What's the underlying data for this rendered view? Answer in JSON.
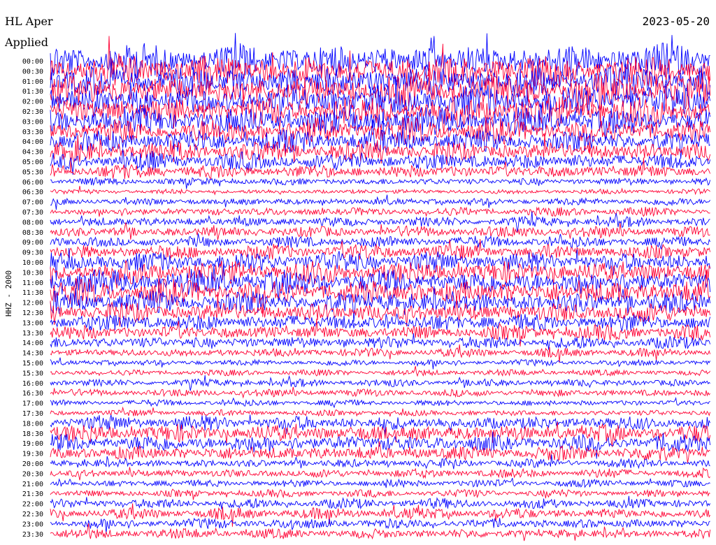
{
  "header": {
    "station": "HL Aper",
    "filter_note": "Applied",
    "date": "2023-05-20"
  },
  "chart_data": {
    "type": "line",
    "title": "",
    "ylabel": "HHZ - 2000",
    "xlabel": "",
    "rows": [
      "00:00",
      "00:30",
      "01:00",
      "01:30",
      "02:00",
      "02:30",
      "03:00",
      "03:30",
      "04:00",
      "04:30",
      "05:00",
      "05:30",
      "06:00",
      "06:30",
      "07:00",
      "07:30",
      "08:00",
      "08:30",
      "09:00",
      "09:30",
      "10:00",
      "10:30",
      "11:00",
      "11:30",
      "12:00",
      "12:30",
      "13:00",
      "13:30",
      "14:00",
      "14:30",
      "15:00",
      "15:30",
      "16:00",
      "16:30",
      "17:00",
      "17:30",
      "18:00",
      "18:30",
      "19:00",
      "19:30",
      "20:00",
      "20:30",
      "21:00",
      "21:30",
      "22:00",
      "22:30",
      "23:00",
      "23:30"
    ],
    "series_colors": [
      "#0000ff",
      "#ff0033"
    ],
    "trace_amplitude": [
      28,
      27,
      26,
      26,
      25,
      24,
      22,
      20,
      18,
      16,
      14,
      11,
      6,
      4,
      6,
      7,
      8,
      9,
      9,
      12,
      16,
      18,
      20,
      20,
      18,
      16,
      14,
      12,
      10,
      7,
      5,
      5,
      6,
      6,
      5,
      5,
      12,
      14,
      14,
      12,
      7,
      7,
      6,
      6,
      8,
      9,
      8,
      8
    ]
  }
}
